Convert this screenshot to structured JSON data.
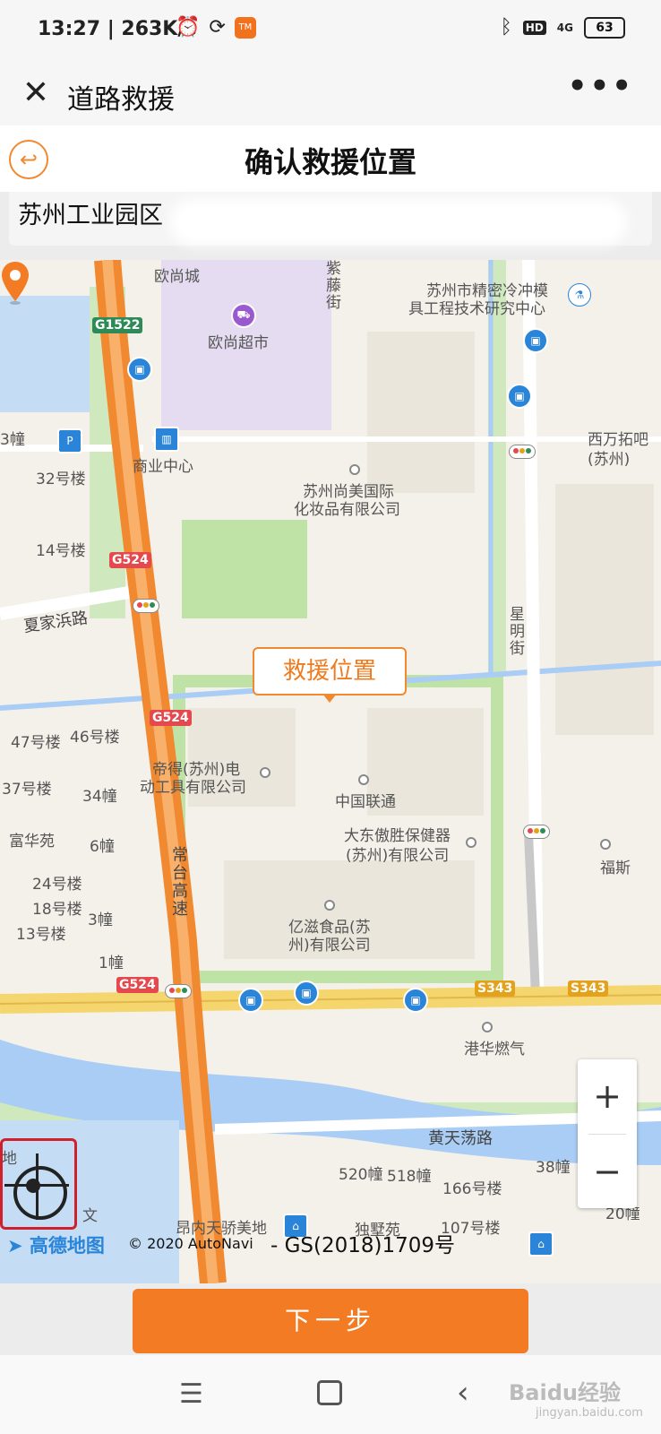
{
  "status_bar": {
    "time": "13:27 | 263K/s",
    "app_badge": "TM",
    "hd": "HD",
    "signal": "4G",
    "battery": "63"
  },
  "app_bar": {
    "close_icon": "✕",
    "title": "道路救援",
    "more_icon": "•••"
  },
  "page": {
    "back_icon": "↩",
    "title": "确认救援位置"
  },
  "address": {
    "value": "苏州工业园区"
  },
  "map": {
    "pin_label": "救援位置",
    "labels": {
      "ouShangCheng": "欧尚城",
      "ouShangSuper": "欧尚超市",
      "ziTengJie": "紫藤街",
      "jingMi": "苏州市精密冷冲模",
      "jingMi2": "具工程技术研究中心",
      "xiWan": "西万拓吧",
      "xiWan2": "(苏州)",
      "shangYe": "商业中心",
      "shangMei": "苏州尚美国际",
      "shangMei2": "化妆品有限公司",
      "b32": "32号楼",
      "b14": "14号楼",
      "b3": "3幢",
      "xiaJia": "夏家浜路",
      "xingMing": "星明街",
      "b47": "47号楼",
      "b46": "46号楼",
      "b37": "37号楼",
      "b34": "34幢",
      "fuHua": "富华苑",
      "b6": "6幢",
      "b24": "24号楼",
      "b18": "18号楼",
      "b3b": "3幢",
      "b13": "13号楼",
      "b1": "1幢",
      "diDe": "帝得(苏州)电",
      "diDe2": "动工具有限公司",
      "unicom": "中国联通",
      "daDong": "大东傲胜保健器",
      "daDong2": "(苏州)有限公司",
      "fuSi": "福斯",
      "yiZi": "亿滋食品(苏",
      "yiZi2": "州)有限公司",
      "changTai": "常台高速",
      "gangHua": "港华燃气",
      "huangTian": "黄天荡路",
      "b520": "520幢",
      "b518": "518幢",
      "b38": "38幢",
      "b166": "166号楼",
      "b107": "107号楼",
      "b20": "20幢",
      "angNei": "昂内天骄美地",
      "duShu": "独墅苑",
      "di": "地",
      "wen": "文"
    },
    "shields": {
      "g1522": "G1522",
      "g524a": "G524",
      "g524b": "G524",
      "g524c": "G524",
      "s343a": "S343",
      "s343b": "S343"
    },
    "zoom_in": "+",
    "zoom_out": "−",
    "logo": "高德地图",
    "copyright": "© 2020 AutoNavi",
    "approval": "- GS(2018)1709号"
  },
  "actions": {
    "next_label": "下一步"
  },
  "nav": {
    "menu_icon": "☰",
    "back_icon": "‹",
    "watermark": "Baidu经验",
    "watermark_sub": "jingyan.baidu.com"
  },
  "colors": {
    "accent": "#f37b24",
    "highway": "#f49a4a",
    "water": "#a9cdf5",
    "green": "#bfe3a7"
  }
}
